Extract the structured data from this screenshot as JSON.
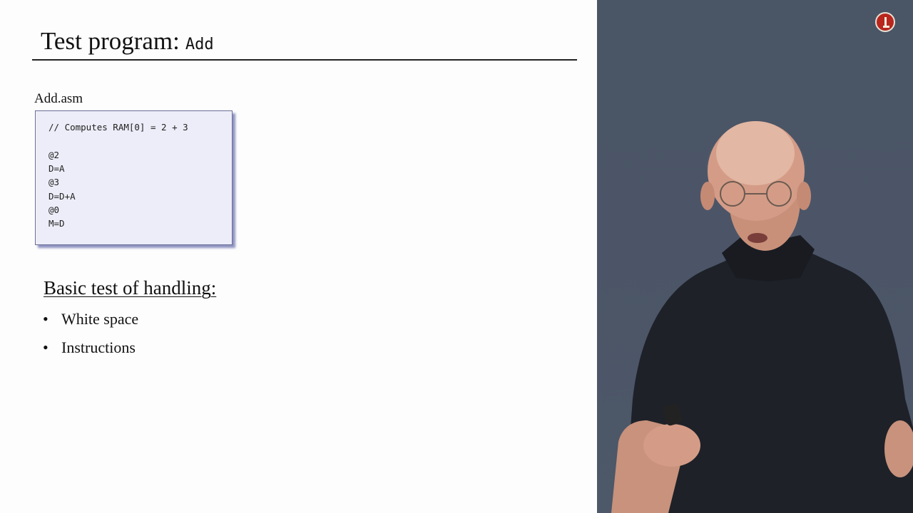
{
  "slide": {
    "title_main": "Test program:",
    "title_code": "Add",
    "file_label": "Add.asm",
    "code_lines": [
      "// Computes RAM[0] = 2 + 3",
      "",
      "@2",
      "D=A",
      "@3",
      "D=D+A",
      "@0",
      "M=D"
    ],
    "subheading": "Basic test of handling:",
    "bullets": [
      "White space",
      "Instructions"
    ],
    "bullet_glyph": "•"
  },
  "video": {
    "background_color": "#4b5567",
    "logo_color": "#b8261d",
    "logo_icon": "course-logo-icon"
  }
}
